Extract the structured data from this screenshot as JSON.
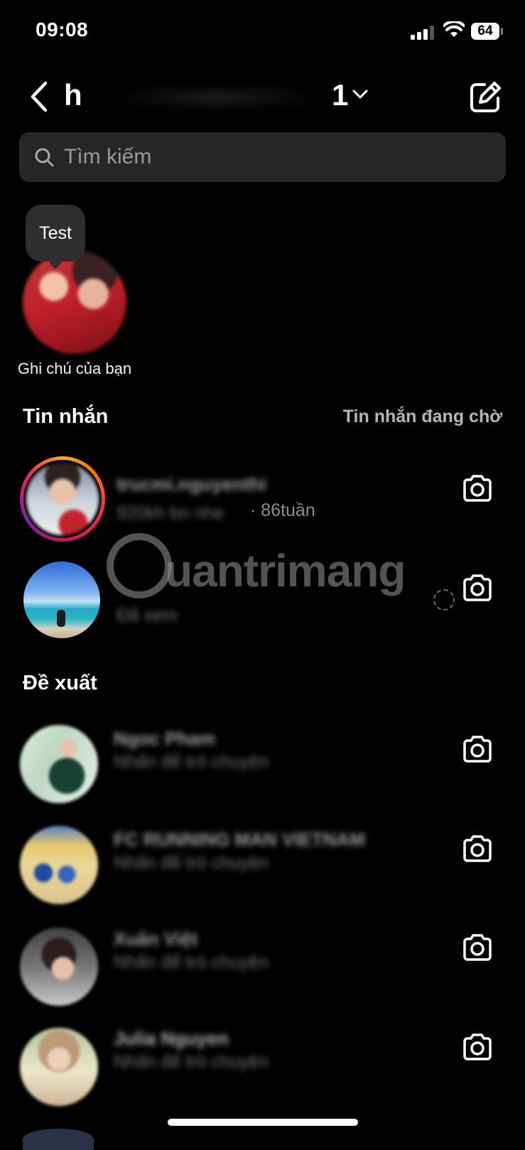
{
  "status_bar": {
    "time": "09:08",
    "battery": "64"
  },
  "header": {
    "username_first": "h",
    "username_last": "1"
  },
  "search": {
    "placeholder": "Tìm kiếm"
  },
  "note": {
    "bubble_text": "Test",
    "label": "Ghi chú của bạn"
  },
  "messages": {
    "title": "Tin nhắn",
    "requests_link": "Tin nhắn đang chờ",
    "items": [
      {
        "name": "trucmi.nguyenthi",
        "preview": "920kh bn nhe",
        "time": "· 86tuần"
      },
      {
        "name": "",
        "preview": "Đã xem"
      }
    ]
  },
  "suggestions": {
    "title": "Đề xuất",
    "items": [
      {
        "name": "Ngoc Pham",
        "preview": "Nhấn để trò chuyện"
      },
      {
        "name": "FC RUNNING MAN VIETNAM",
        "preview": "Nhấn để trò chuyện"
      },
      {
        "name": "Xuân Việt",
        "preview": "Nhấn để trò chuyện"
      },
      {
        "name": "Julia Nguyen",
        "preview": "Nhấn để trò chuyện"
      }
    ]
  },
  "watermark": {
    "text": "uantrimang"
  },
  "icons": [
    "back-chevron-icon",
    "chevron-down-icon",
    "compose-icon",
    "search-icon",
    "camera-icon",
    "signal-icon",
    "wifi-icon",
    "battery-icon"
  ],
  "colors": {
    "background": "#000000",
    "search_bg": "#262626",
    "muted_text": "#b6b6b6"
  }
}
